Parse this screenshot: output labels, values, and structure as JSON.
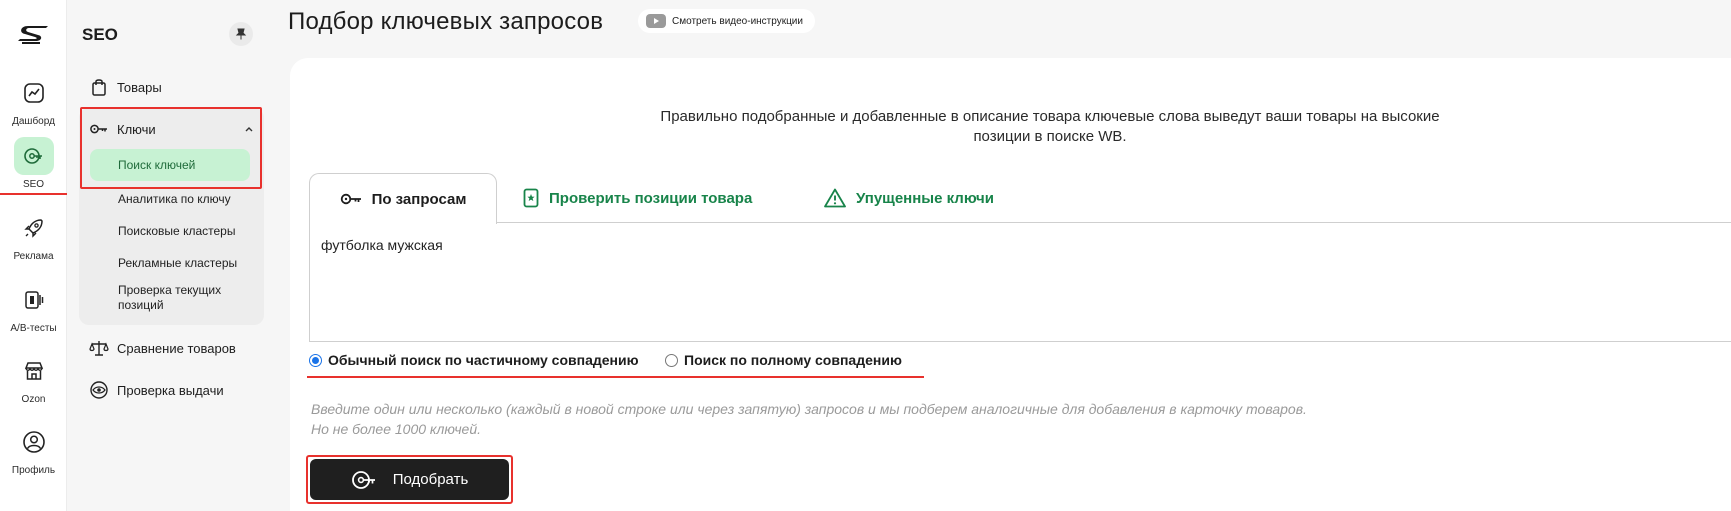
{
  "rail": {
    "items": [
      {
        "label": "Дашборд",
        "icon": "chart-icon"
      },
      {
        "label": "SEO",
        "icon": "key-search-icon",
        "active": true
      },
      {
        "label": "Реклама",
        "icon": "rocket-icon"
      },
      {
        "label": "A/B-тесты",
        "icon": "ab-test-icon"
      },
      {
        "label": "Ozon",
        "icon": "store-icon"
      },
      {
        "label": "Профиль",
        "icon": "user-icon"
      }
    ]
  },
  "sidebar": {
    "title": "SEO",
    "items": {
      "products": "Товары",
      "keys": "Ключи",
      "key_search": "Поиск ключей",
      "key_analytics": "Аналитика по ключу",
      "search_clusters": "Поисковые кластеры",
      "ad_clusters": "Рекламные кластеры",
      "check_positions": "Проверка текущих позиций",
      "compare_products": "Сравнение товаров",
      "check_results": "Проверка выдачи"
    }
  },
  "header": {
    "title": "Подбор ключевых запросов",
    "video_button": "Смотреть видео-инструкции"
  },
  "main": {
    "intro": "Правильно подобранные и добавленные в описание товара ключевые слова выведут ваши товары на высокие позиции в поиске WB.",
    "tabs": [
      "По запросам",
      "Проверить позиции товара",
      "Упущенные ключи"
    ],
    "query_value": "футболка мужская",
    "radio_partial": "Обычный поиск по частичному совпадению",
    "radio_full": "Поиск по полному совпадению",
    "hint_line1": "Введите один или несколько (каждый в новой строке или через запятую) запросов и мы подберем аналогичные для добавления в карточку товаров.",
    "hint_line2": "Но не более 1000 ключей.",
    "submit_label": "Подобрать"
  },
  "colors": {
    "accent_green": "#18844a",
    "active_bg": "#c7f2d3",
    "highlight_red": "#e8312d",
    "button_dark": "#1f1f1f"
  }
}
